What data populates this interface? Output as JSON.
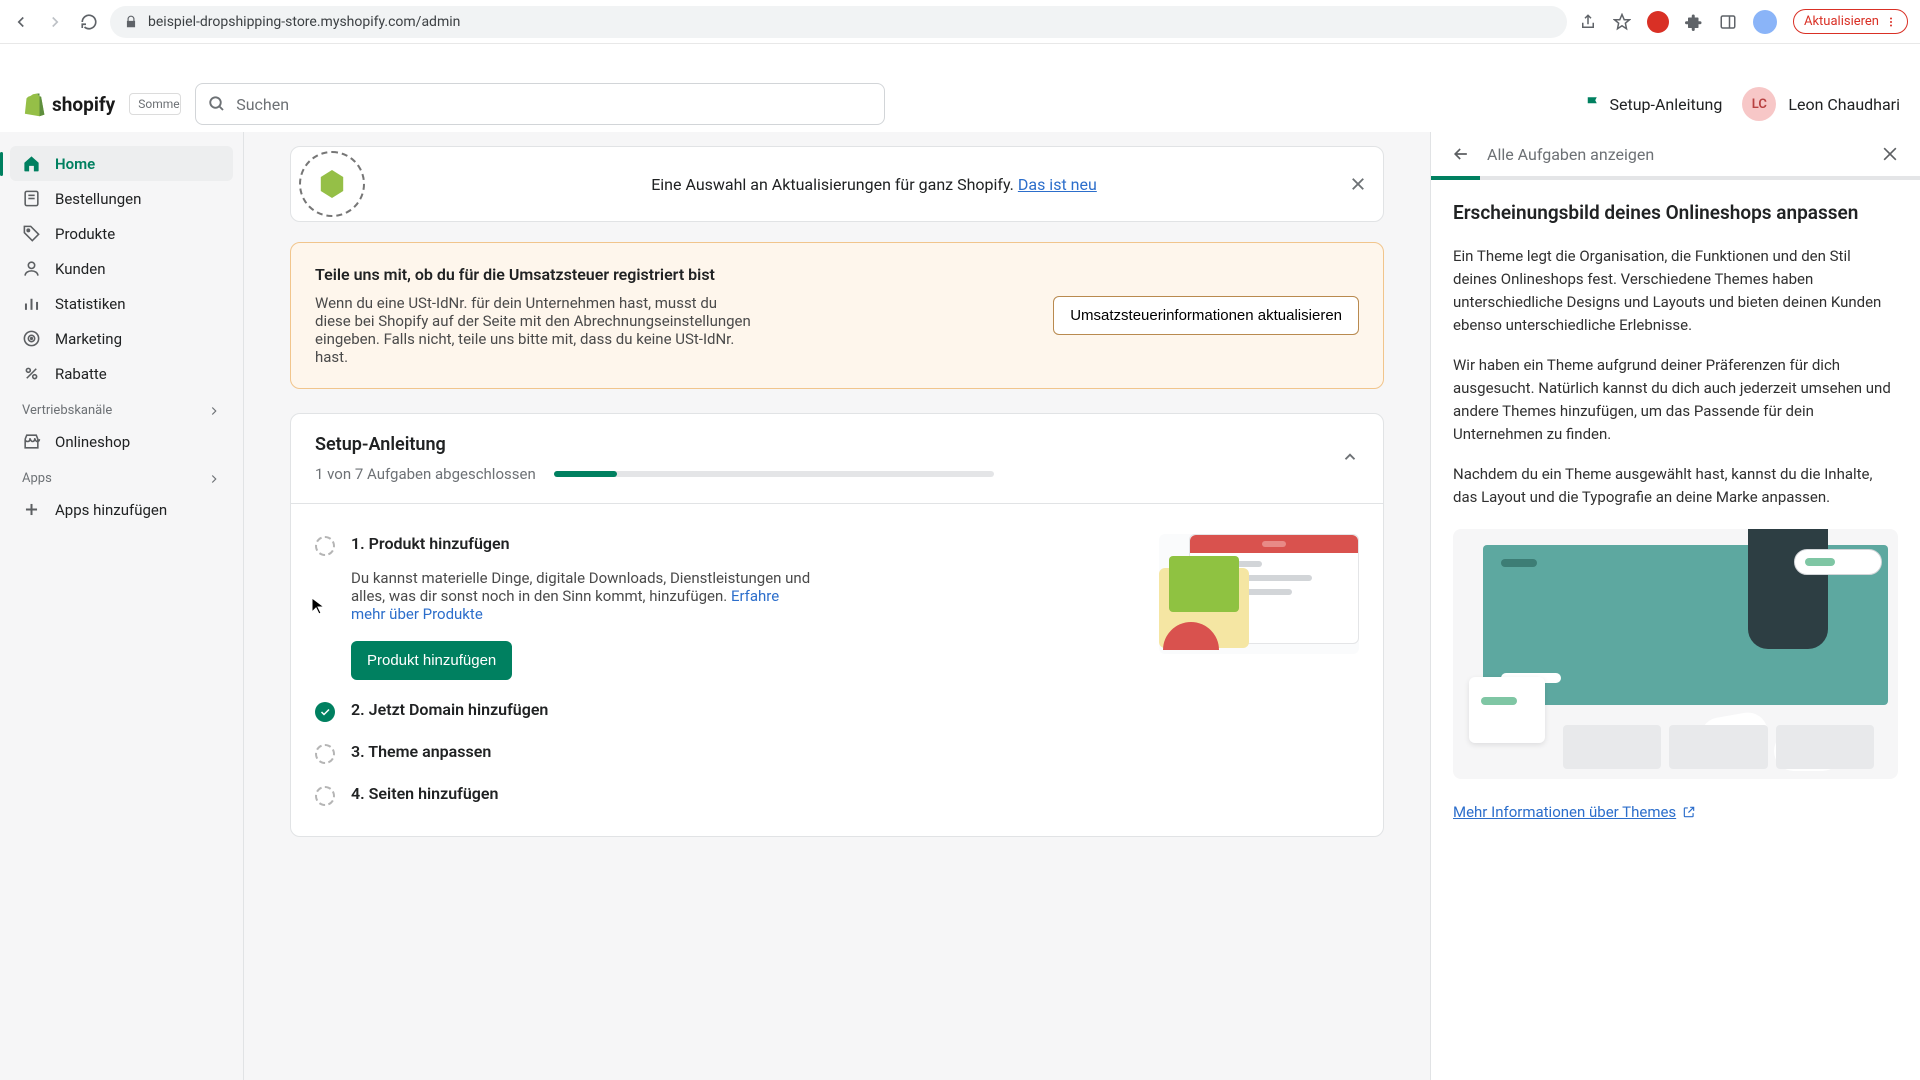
{
  "browser": {
    "url": "beispiel-dropshipping-store.myshopify.com/admin",
    "update_label": "Aktualisieren"
  },
  "header": {
    "logo_text": "shopify",
    "trial_pill": "Sommer",
    "search_placeholder": "Suchen",
    "setup_link": "Setup-Anleitung",
    "user_initials": "LC",
    "user_name": "Leon Chaudhari"
  },
  "sidebar": {
    "items": [
      {
        "label": "Home",
        "icon": "home",
        "active": true
      },
      {
        "label": "Bestellungen",
        "icon": "orders"
      },
      {
        "label": "Produkte",
        "icon": "products"
      },
      {
        "label": "Kunden",
        "icon": "customers"
      },
      {
        "label": "Statistiken",
        "icon": "analytics"
      },
      {
        "label": "Marketing",
        "icon": "marketing"
      },
      {
        "label": "Rabatte",
        "icon": "discounts"
      }
    ],
    "channels_label": "Vertriebskanäle",
    "channel_item": "Onlineshop",
    "apps_label": "Apps",
    "add_apps": "Apps hinzufügen"
  },
  "editions_banner": {
    "text": "Eine Auswahl an Aktualisierungen für ganz Shopify. ",
    "link": "Das ist neu"
  },
  "vat": {
    "title": "Teile uns mit, ob du für die Umsatzsteuer registriert bist",
    "body": "Wenn du eine USt-IdNr. für dein Unternehmen hast, musst du diese bei Shopify auf der Seite mit den Abrechnungseinstellungen eingeben. Falls nicht, teile uns bitte mit, dass du keine USt-IdNr. hast.",
    "button": "Umsatzsteuerinformationen aktualisieren"
  },
  "setup": {
    "title": "Setup-Anleitung",
    "progress_text": "1 von 7 Aufgaben abgeschlossen",
    "tasks": [
      {
        "title": "1. Produkt hinzufügen",
        "desc": "Du kannst materielle Dinge, digitale Downloads, Dienstleistungen und alles, was dir sonst noch in den Sinn kommt, hinzufügen. ",
        "desc_link": "Erfahre mehr über Produkte",
        "button": "Produkt hinzufügen",
        "done": false,
        "expanded": true
      },
      {
        "title": "2. Jetzt Domain hinzufügen",
        "done": true
      },
      {
        "title": "3. Theme anpassen",
        "done": false
      },
      {
        "title": "4. Seiten hinzufügen",
        "done": false
      }
    ]
  },
  "panel": {
    "back_label": "Alle Aufgaben anzeigen",
    "title": "Erscheinungsbild deines Onlineshops anpassen",
    "p1": "Ein Theme legt die Organisation, die Funktionen und den Stil deines Onlineshops fest. Verschiedene Themes haben unterschiedliche Designs und Layouts und bieten deinen Kunden ebenso unterschiedliche Erlebnisse.",
    "p2": "Wir haben ein Theme aufgrund deiner Präferenzen für dich ausgesucht. Natürlich kannst du dich auch jederzeit umsehen und andere Themes hinzufügen, um das Passende für dein Unternehmen zu finden.",
    "p3": "Nachdem du ein Theme ausgewählt hast, kannst du die Inhalte, das Layout und die Typografie an deine Marke anpassen.",
    "link": "Mehr Informationen über Themes"
  }
}
